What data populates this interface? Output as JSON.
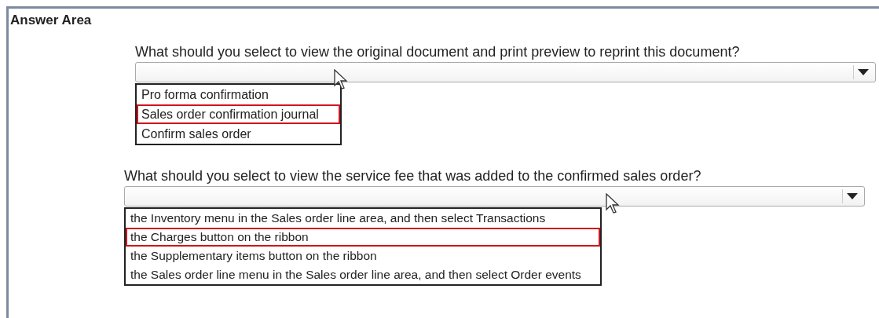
{
  "heading": "Answer Area",
  "questions": [
    {
      "prompt": "What should you select to view the original document and print preview to reprint this document?",
      "options": [
        {
          "label": "Pro forma confirmation",
          "selected": false
        },
        {
          "label": "Sales order confirmation journal",
          "selected": true
        },
        {
          "label": "Confirm sales order",
          "selected": false
        }
      ]
    },
    {
      "prompt": "What should you select to view the service fee that was added to the confirmed sales order?",
      "options": [
        {
          "label": "the Inventory menu in the Sales order line area, and then select Transactions",
          "selected": false
        },
        {
          "label": "the Charges button on the ribbon",
          "selected": true
        },
        {
          "label": "the Supplementary items button on the ribbon",
          "selected": false
        },
        {
          "label": "the Sales order line menu in the Sales order line area, and then select Order events",
          "selected": false
        }
      ]
    }
  ]
}
